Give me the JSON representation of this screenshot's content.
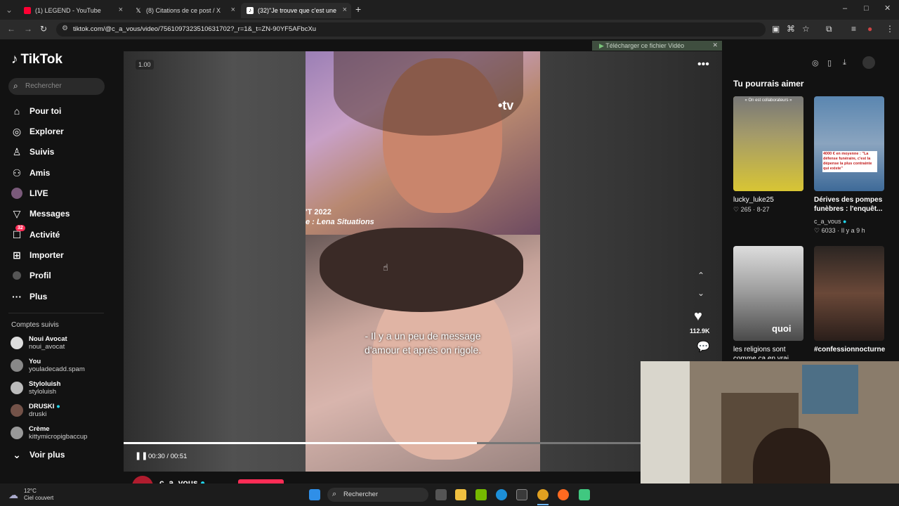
{
  "browser": {
    "tabs": [
      {
        "title": "(1) LEGEND - YouTube",
        "active": false,
        "favicon_color": "#ff0033"
      },
      {
        "title": "(8) Citations de ce post / X",
        "active": false,
        "favicon_color": "#ffffff"
      },
      {
        "title": "(32)\"Je trouve que c'est une",
        "active": true,
        "favicon_color": "#111111"
      }
    ],
    "url": "tiktok.com/@c_a_vous/video/7561097323510631702?_r=1&_t=ZN-90YF5AFbcXu"
  },
  "download_bar": {
    "label": "Télécharger ce fichier Vidéo"
  },
  "sidebar": {
    "logo": "TikTok",
    "search_placeholder": "Rechercher",
    "nav": [
      {
        "label": "Pour toi",
        "icon": "home-icon"
      },
      {
        "label": "Explorer",
        "icon": "compass-icon"
      },
      {
        "label": "Suivis",
        "icon": "following-icon"
      },
      {
        "label": "Amis",
        "icon": "friends-icon"
      },
      {
        "label": "LIVE",
        "icon": "live-icon"
      },
      {
        "label": "Messages",
        "icon": "messages-icon"
      },
      {
        "label": "Activité",
        "icon": "activity-icon",
        "badge": "32"
      },
      {
        "label": "Importer",
        "icon": "upload-icon"
      },
      {
        "label": "Profil",
        "icon": "profile-icon"
      },
      {
        "label": "Plus",
        "icon": "more-icon"
      }
    ],
    "followed_title": "Comptes suivis",
    "followed": [
      {
        "name": "Noui Avocat",
        "handle": "noui_avocat"
      },
      {
        "name": "You",
        "handle": "youladecadd.spam"
      },
      {
        "name": "Styloluish",
        "handle": "styloluish"
      },
      {
        "name": "DRUSKI",
        "handle": "druski",
        "verified": true
      },
      {
        "name": "Crème",
        "handle": "kittymicropigbaccup"
      }
    ],
    "see_more": "Voir plus"
  },
  "video": {
    "speed": "1.00",
    "overlay_logo": "•tv",
    "caption_line1": "'T 2022",
    "caption_line2": "e : Lena Situations",
    "subtitle_line1": "- Il y a un peu de message",
    "subtitle_line2": "d'amour et après on rigole.",
    "time": "00:30 / 00:51",
    "progress": 0.59,
    "likes": "112.9K",
    "author": "c_a_vous"
  },
  "right": {
    "title": "Tu pourrais aimer",
    "items": [
      {
        "caption": "lucky_luke25",
        "meta": "♡ 265 · 8-27",
        "overlay": "« On est collaborateurs »",
        "color": "#c9b23a"
      },
      {
        "caption": "Dérives des pompes funèbres : l'enquêt...",
        "meta": "♡ 6033 · Il y a 9 h",
        "author": "c_a_vous",
        "overlay": "4000 € en moyenne : \"La défense funéraire, c'est la dépense la plus contrainte qui existe\"",
        "color": "#5a86b0"
      },
      {
        "caption": "les religions sont comme ça en vrai",
        "overlay": "quoi",
        "color": "#6b6b6b"
      },
      {
        "caption": "#confessionnocturne",
        "color": "#3a2e2a"
      }
    ]
  },
  "taskbar": {
    "weather_temp": "12°C",
    "weather_desc": "Ciel couvert",
    "search_label": "Rechercher"
  }
}
